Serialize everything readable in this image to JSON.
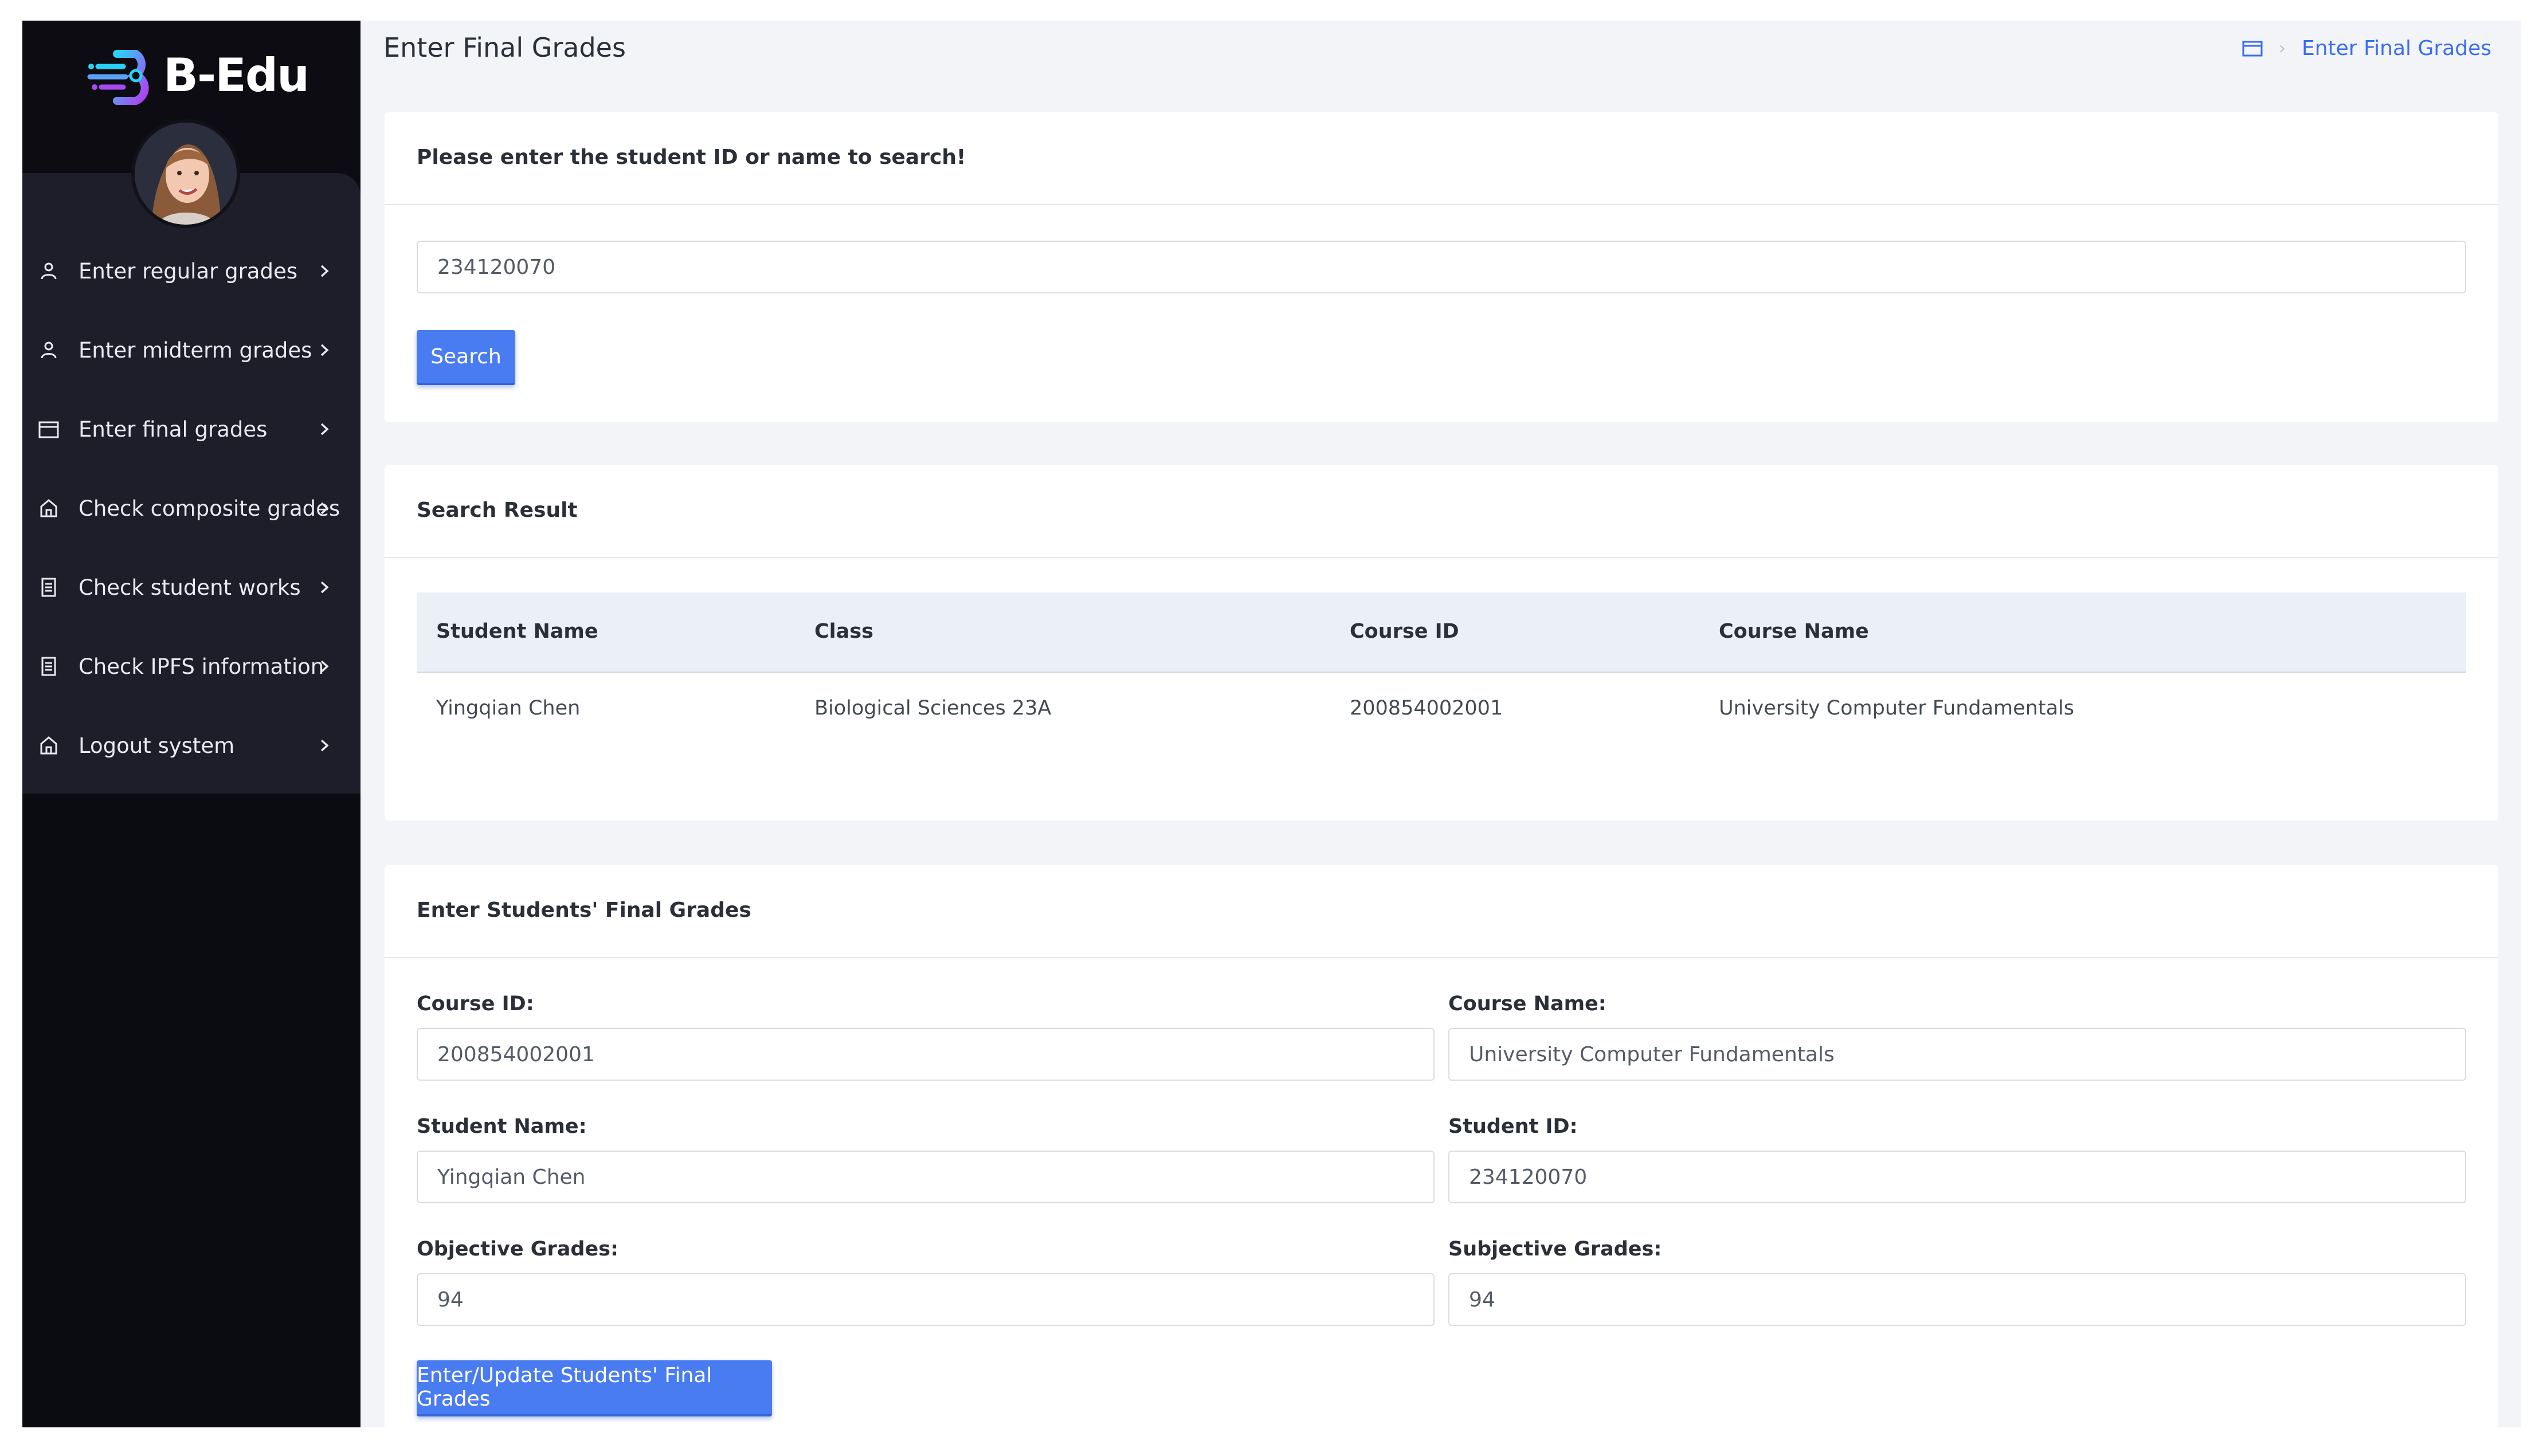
{
  "app": {
    "logo_text": "B-Edu"
  },
  "sidebar": {
    "items": [
      {
        "label": "Enter regular grades",
        "icon": "user-icon"
      },
      {
        "label": "Enter midterm grades",
        "icon": "user-icon"
      },
      {
        "label": "Enter final grades",
        "icon": "calendar-icon"
      },
      {
        "label": "Check composite grades",
        "icon": "home-icon"
      },
      {
        "label": "Check student works",
        "icon": "document-icon"
      },
      {
        "label": "Check IPFS information",
        "icon": "document-icon"
      },
      {
        "label": "Logout system",
        "icon": "home-icon"
      }
    ]
  },
  "header": {
    "title": "Enter Final Grades",
    "breadcrumb": "Enter Final Grades"
  },
  "search": {
    "title": "Please enter the student ID or name to search!",
    "value": "234120070",
    "button": "Search"
  },
  "result": {
    "title": "Search Result",
    "columns": [
      "Student Name",
      "Class",
      "Course ID",
      "Course Name"
    ],
    "rows": [
      [
        "Yingqian Chen",
        "Biological Sciences 23A",
        "200854002001",
        "University Computer Fundamentals"
      ]
    ]
  },
  "form": {
    "title": "Enter Students' Final Grades",
    "course_id_label": "Course ID:",
    "course_id": "200854002001",
    "course_name_label": "Course Name:",
    "course_name": "University Computer Fundamentals",
    "student_name_label": "Student Name:",
    "student_name": "Yingqian Chen",
    "student_id_label": "Student ID:",
    "student_id": "234120070",
    "objective_label": "Objective Grades:",
    "objective": "94",
    "subjective_label": "Subjective Grades:",
    "subjective": "94",
    "submit": "Enter/Update Students' Final Grades"
  },
  "colors": {
    "accent": "#4a7cf1",
    "sidebar": "#1d1e2a",
    "sidebar_dark": "#0b0b12",
    "background": "#f3f4f8"
  }
}
